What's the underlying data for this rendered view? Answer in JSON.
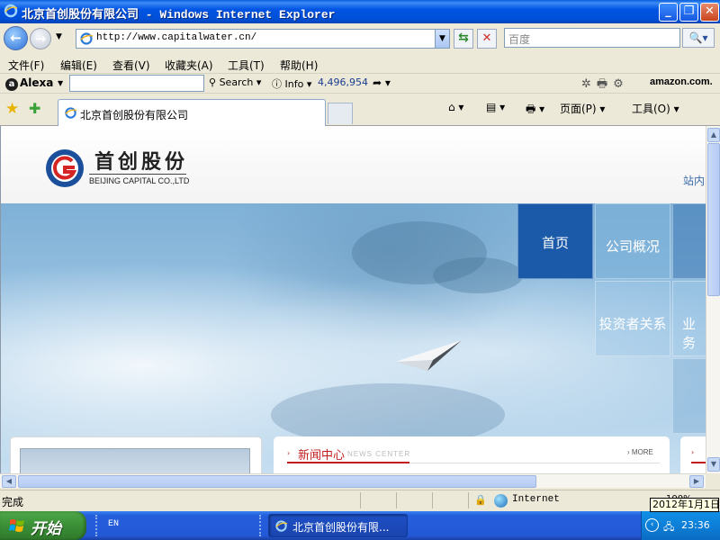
{
  "window": {
    "title": "北京首创股份有限公司 - Windows Internet Explorer",
    "min_label": "_",
    "max_label": "❐",
    "close_label": "✕"
  },
  "address": {
    "url": "http://www.capitalwater.cn/",
    "search_placeholder": "百度",
    "back_label": "←",
    "forward_label": "→",
    "refresh_label": "⇆",
    "stop_label": "✕",
    "go_label": "🔍▾"
  },
  "menu": [
    "文件(F)",
    "编辑(E)",
    "查看(V)",
    "收藏夹(A)",
    "工具(T)",
    "帮助(H)"
  ],
  "alexa": {
    "logo": "Alexa",
    "search": "Search ▾",
    "info": "Info ▾",
    "rank": "4,496,954",
    "amazon": "amazon.com."
  },
  "tabs": {
    "active_title": "北京首创股份有限公司",
    "home_cmd": "⌂ ▾",
    "feed_cmd": "▤ ▾",
    "print_cmd": "🖶 ▾",
    "page_cmd": "页面(P) ▾",
    "tools_cmd": "工具(O) ▾"
  },
  "site": {
    "logo_cn": "首创股份",
    "logo_en": "BEIJING CAPITAL CO.,LTD",
    "site_search": "站内",
    "nav": [
      "首页",
      "公司概况",
      "投资者关系",
      "业务"
    ],
    "news_title": "新闻中心",
    "news_sub": "NEWS CENTER",
    "news_more": "› MORE"
  },
  "status": {
    "text": "完成",
    "zone": "Internet",
    "zoom": "100%",
    "tooltip": "2012年1月1日"
  },
  "taskbar": {
    "start": "开始",
    "lang": "EN",
    "task_title": "北京首创股份有限...",
    "clock": "23:36"
  },
  "colors": {
    "titlebar": "#0054e3",
    "home_tile": "#1b5aa8",
    "news_red": "#c21d1d"
  }
}
